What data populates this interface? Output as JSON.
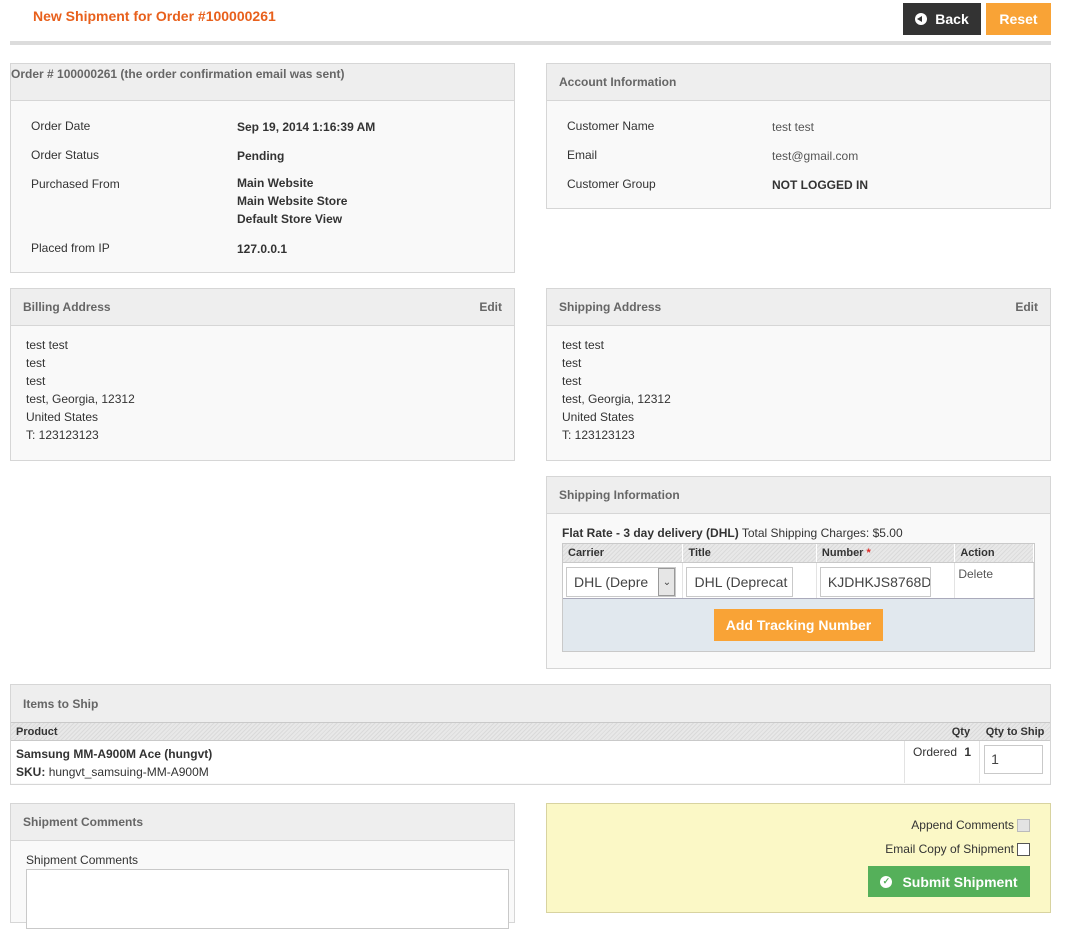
{
  "header": {
    "title": "New Shipment for Order #100000261",
    "back_label": "Back",
    "reset_label": "Reset"
  },
  "order": {
    "title": "Order # 100000261 (the order confirmation email was sent)",
    "rows": [
      {
        "label": "Order Date",
        "value": "Sep 19, 2014 1:16:39 AM"
      },
      {
        "label": "Order Status",
        "value": "Pending"
      },
      {
        "label": "Purchased From",
        "value_lines": [
          "Main Website",
          "Main Website Store",
          "Default Store View"
        ]
      },
      {
        "label": "Placed from IP",
        "value": "127.0.0.1"
      }
    ]
  },
  "account": {
    "title": "Account Information",
    "rows": [
      {
        "label": "Customer Name",
        "value": "test test"
      },
      {
        "label": "Email",
        "value": "test@gmail.com"
      },
      {
        "label": "Customer Group",
        "value": "NOT LOGGED IN"
      }
    ]
  },
  "billing": {
    "title": "Billing Address",
    "edit_label": "Edit",
    "lines": [
      "test test",
      "test",
      "test",
      "test, Georgia, 12312",
      "United States",
      "T: 123123123"
    ]
  },
  "shipping_address": {
    "title": "Shipping Address",
    "edit_label": "Edit",
    "lines": [
      "test test",
      "test",
      "test",
      "test, Georgia, 12312",
      "United States",
      "T: 123123123"
    ]
  },
  "shipping_info": {
    "title": "Shipping Information",
    "method": "Flat Rate - 3 day delivery (DHL)",
    "charges": "Total Shipping Charges: $5.00",
    "columns": {
      "carrier": "Carrier",
      "title": "Title",
      "number": "Number",
      "required": "*",
      "action": "Action"
    },
    "row": {
      "carrier": "DHL (Depre",
      "title": "DHL (Deprecat",
      "number": "KJDHKJS8768D",
      "action": "Delete"
    },
    "add_label": "Add Tracking Number"
  },
  "items": {
    "title": "Items to Ship",
    "columns": {
      "product": "Product",
      "qty": "Qty",
      "qty_to_ship": "Qty to Ship"
    },
    "rows": [
      {
        "name": "Samsung MM-A900M Ace (hungvt)",
        "sku_label": "SKU:",
        "sku": "hungvt_samsuing-MM-A900M",
        "ordered_label": "Ordered",
        "ordered": "1",
        "qty_to_ship": "1"
      }
    ]
  },
  "comments": {
    "title": "Shipment Comments",
    "field_label": "Shipment Comments",
    "value": ""
  },
  "submit": {
    "append_label": "Append Comments",
    "email_label": "Email Copy of Shipment",
    "submit_label": "Submit Shipment"
  }
}
